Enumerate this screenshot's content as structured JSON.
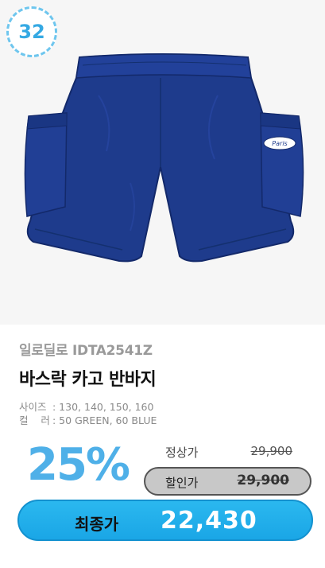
{
  "product": {
    "number_badge": "32",
    "patch_text": "Paris",
    "brand": "일로딜로 IDTA2541Z",
    "title": "바스락 카고 반바지",
    "specs": [
      {
        "label": "사이즈",
        "value": ": 130, 140, 150, 160"
      },
      {
        "label": "컬    러",
        "value": ": 50 GREEN, 60 BLUE"
      }
    ]
  },
  "pricing": {
    "discount_percent": "25%",
    "regular_label": "정상가",
    "regular_price": "29,900",
    "sale_label": "할인가",
    "sale_price": "29,900",
    "final_label": "최종가",
    "final_price": "22,430"
  },
  "colors": {
    "accent": "#35a9e3",
    "shorts": "#1e3b8c"
  }
}
